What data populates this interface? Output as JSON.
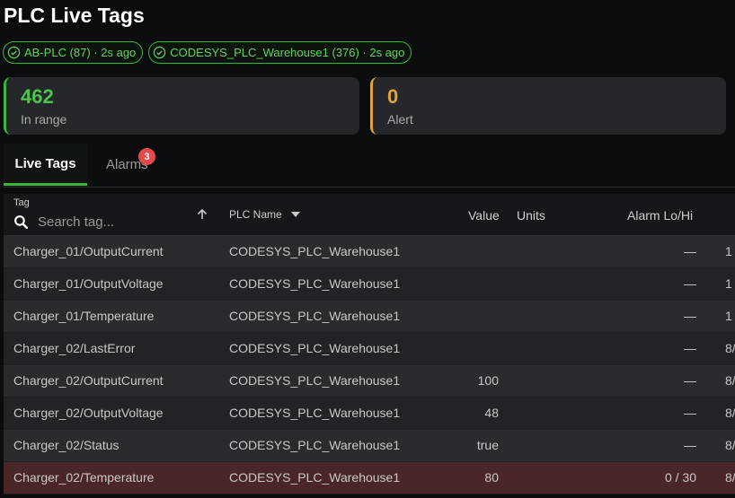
{
  "page": {
    "title": "PLC Live Tags"
  },
  "chips": [
    {
      "label": "AB-PLC (87) · 2s ago"
    },
    {
      "label": "CODESYS_PLC_Warehouse1 (376) · 2s ago"
    }
  ],
  "stats": {
    "in_range": {
      "value": "462",
      "label": "In range"
    },
    "alert": {
      "value": "0",
      "label": "Alert"
    }
  },
  "tabs": {
    "live": "Live Tags",
    "alarms": "Alarms",
    "alarms_badge": "3"
  },
  "table": {
    "headers": {
      "tag": "Tag",
      "plc": "PLC Name",
      "value": "Value",
      "units": "Units",
      "alarm": "Alarm Lo/Hi"
    },
    "search_placeholder": "Search tag...",
    "rows": [
      {
        "tag": "Charger_01/OutputCurrent",
        "plc": "CODESYS_PLC_Warehouse1",
        "value": "",
        "units": "",
        "alarm": "—",
        "extra": "1"
      },
      {
        "tag": "Charger_01/OutputVoltage",
        "plc": "CODESYS_PLC_Warehouse1",
        "value": "",
        "units": "",
        "alarm": "—",
        "extra": "1"
      },
      {
        "tag": "Charger_01/Temperature",
        "plc": "CODESYS_PLC_Warehouse1",
        "value": "",
        "units": "",
        "alarm": "—",
        "extra": "1"
      },
      {
        "tag": "Charger_02/LastError",
        "plc": "CODESYS_PLC_Warehouse1",
        "value": "",
        "units": "",
        "alarm": "—",
        "extra": "8/"
      },
      {
        "tag": "Charger_02/OutputCurrent",
        "plc": "CODESYS_PLC_Warehouse1",
        "value": "100",
        "units": "",
        "alarm": "—",
        "extra": "8/"
      },
      {
        "tag": "Charger_02/OutputVoltage",
        "plc": "CODESYS_PLC_Warehouse1",
        "value": "48",
        "units": "",
        "alarm": "—",
        "extra": "8/"
      },
      {
        "tag": "Charger_02/Status",
        "plc": "CODESYS_PLC_Warehouse1",
        "value": "true",
        "units": "",
        "alarm": "—",
        "extra": "8/"
      },
      {
        "tag": "Charger_02/Temperature",
        "plc": "CODESYS_PLC_Warehouse1",
        "value": "80",
        "units": "",
        "alarm": "0 / 30",
        "extra": "8/",
        "state": "alert"
      }
    ]
  },
  "colors": {
    "accent_green": "#3db43d",
    "accent_orange": "#e0a43a",
    "alert_row": "#4b2628",
    "badge_red": "#e24b4b"
  },
  "icons": {
    "chip": "check-circle-icon",
    "search": "search-icon",
    "sort": "arrow-up-icon",
    "dropdown": "caret-down-icon"
  }
}
